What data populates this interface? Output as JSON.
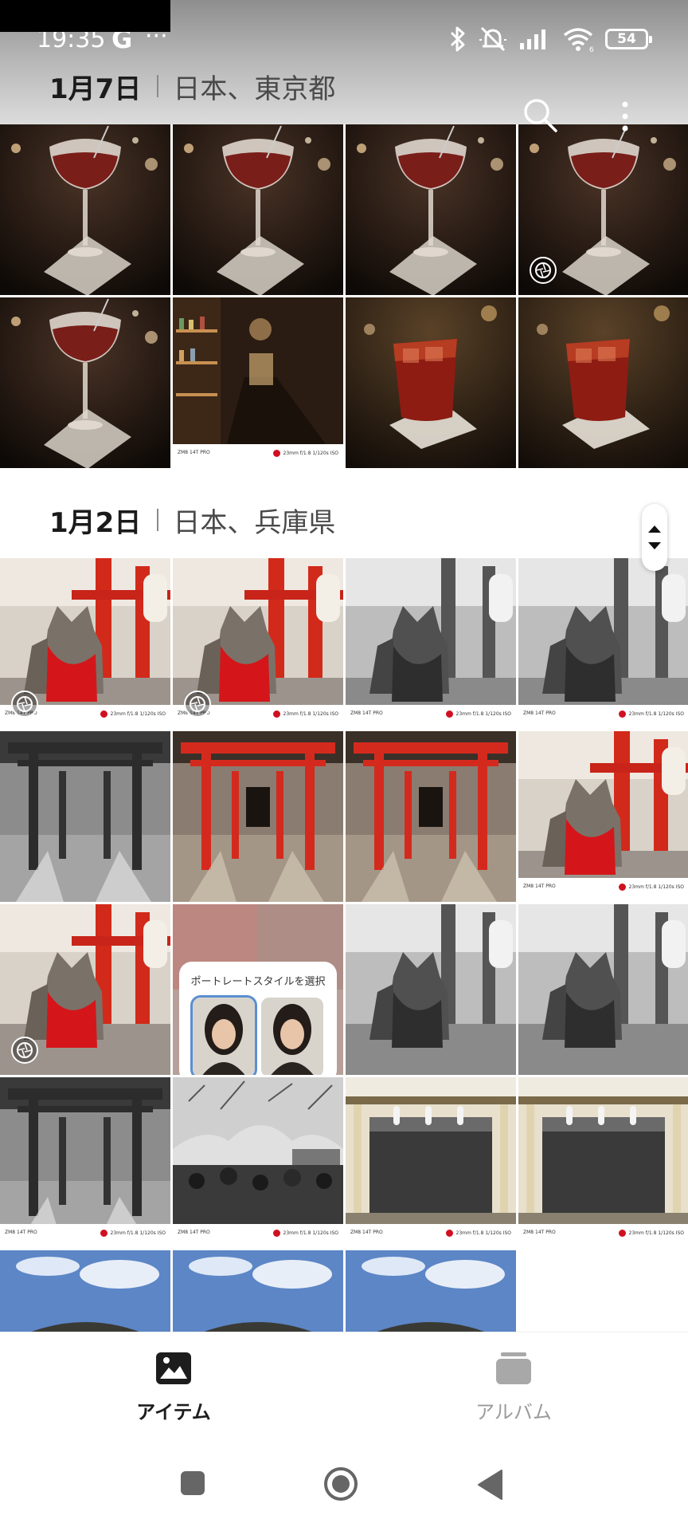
{
  "status_bar": {
    "time": "19:35",
    "google_glyph": "G",
    "more_glyph": "···",
    "battery": "54",
    "icons": [
      "bluetooth-icon",
      "mute-icon",
      "signal-icon",
      "wifi-icon",
      "battery-icon"
    ]
  },
  "toolbar": {
    "icons": [
      "search-icon",
      "more-vertical-icon"
    ]
  },
  "sections": [
    {
      "date": "1月7日",
      "location": "日本、東京都",
      "photos": [
        {
          "kind": "cocktail-coupe",
          "badge": false
        },
        {
          "kind": "cocktail-coupe",
          "badge": false
        },
        {
          "kind": "cocktail-coupe",
          "badge": false
        },
        {
          "kind": "cocktail-coupe",
          "badge": true
        },
        {
          "kind": "cocktail-coupe",
          "badge": false
        },
        {
          "kind": "bar-interior",
          "badge": false,
          "leica": true
        },
        {
          "kind": "cocktail-rocks",
          "badge": false
        },
        {
          "kind": "cocktail-rocks",
          "badge": false
        }
      ]
    },
    {
      "date": "1月2日",
      "location": "日本、兵庫県",
      "photos": [
        {
          "kind": "fox-color",
          "badge": true,
          "leica": true
        },
        {
          "kind": "fox-color",
          "badge": true,
          "leica": true
        },
        {
          "kind": "fox-mono",
          "badge": false,
          "leica": true
        },
        {
          "kind": "fox-mono",
          "badge": false,
          "leica": true
        },
        {
          "kind": "torii-mono",
          "badge": false
        },
        {
          "kind": "torii-color",
          "badge": false
        },
        {
          "kind": "torii-color",
          "badge": false
        },
        {
          "kind": "fox-color",
          "badge": false,
          "leica": true
        },
        {
          "kind": "fox-color",
          "badge": true
        },
        {
          "kind": "portrait-style",
          "badge": false
        },
        {
          "kind": "fox-mono",
          "badge": false
        },
        {
          "kind": "fox-mono",
          "badge": false
        },
        {
          "kind": "torii-mono",
          "badge": false,
          "leica": true
        },
        {
          "kind": "crowd-mono",
          "badge": false,
          "leica": true
        },
        {
          "kind": "shrine-hall",
          "badge": false,
          "leica": true
        },
        {
          "kind": "shrine-hall",
          "badge": false,
          "leica": true
        },
        {
          "kind": "shrine-roof",
          "badge": false
        },
        {
          "kind": "shrine-roof",
          "badge": false
        },
        {
          "kind": "shrine-roof",
          "badge": false
        }
      ]
    }
  ],
  "portrait_card": {
    "title": "ポートレートスタイルを選択"
  },
  "leica_strip": {
    "left": "ZM8 14T PRO",
    "right": "23mm f/1.8 1/120s ISO"
  },
  "bottom_nav": {
    "items_label": "アイテム",
    "albums_label": "アルバム"
  },
  "colors": {
    "leica_red": "#d01020",
    "torii_red": "#d42a1e",
    "accent_selected": "#1d1d1d",
    "inactive": "#9b9b9b"
  }
}
